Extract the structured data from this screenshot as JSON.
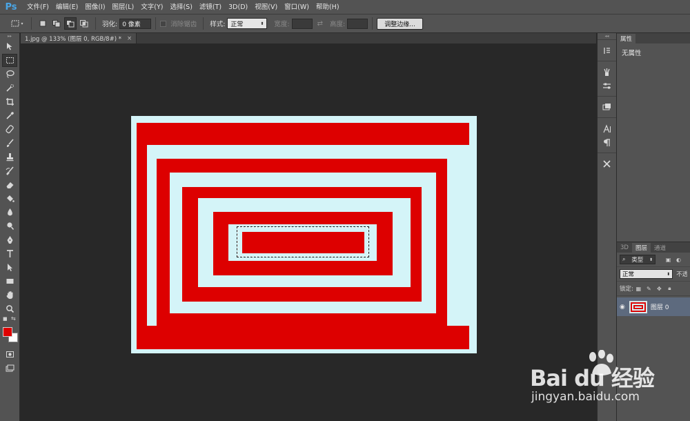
{
  "app": {
    "logo": "Ps"
  },
  "menu": [
    "文件(F)",
    "编辑(E)",
    "图像(I)",
    "图层(L)",
    "文字(Y)",
    "选择(S)",
    "滤镜(T)",
    "3D(D)",
    "视图(V)",
    "窗口(W)",
    "帮助(H)"
  ],
  "options": {
    "feather_label": "羽化:",
    "feather_value": "0 像素",
    "antialias_label": "消除锯齿",
    "style_label": "样式:",
    "style_value": "正常",
    "width_label": "宽度:",
    "height_label": "高度:",
    "refine_button": "调整边缘..."
  },
  "document": {
    "tab_title": "1.jpg @ 133% (图层 0, RGB/8#) *",
    "tab_close": "×"
  },
  "colors": {
    "canvas_bg": "#d4f4f8",
    "stripe": "#dd0000",
    "foreground": "#dd0000",
    "background": "#ffffff"
  },
  "toolbar": {
    "tools": [
      "move-tool",
      "rect-marquee-tool",
      "lasso-tool",
      "quick-select-tool",
      "crop-tool",
      "eyedropper-tool",
      "healing-brush-tool",
      "brush-tool",
      "clone-stamp-tool",
      "history-brush-tool",
      "eraser-tool",
      "paint-bucket-tool",
      "blur-tool",
      "dodge-tool",
      "pen-tool",
      "type-tool",
      "path-select-tool",
      "rectangle-tool",
      "hand-tool",
      "zoom-tool"
    ]
  },
  "properties_panel": {
    "tab": "属性",
    "body": "无属性"
  },
  "layers_panel": {
    "tabs": [
      "3D",
      "图层",
      "通道"
    ],
    "filter_kind": "类型",
    "blend_mode": "正常",
    "opacity_label": "不透",
    "lock_label": "锁定:",
    "layer_name": "图层 0"
  },
  "watermark": {
    "logo_text": "Bai du 经验",
    "url": "jingyan.baidu.com"
  }
}
